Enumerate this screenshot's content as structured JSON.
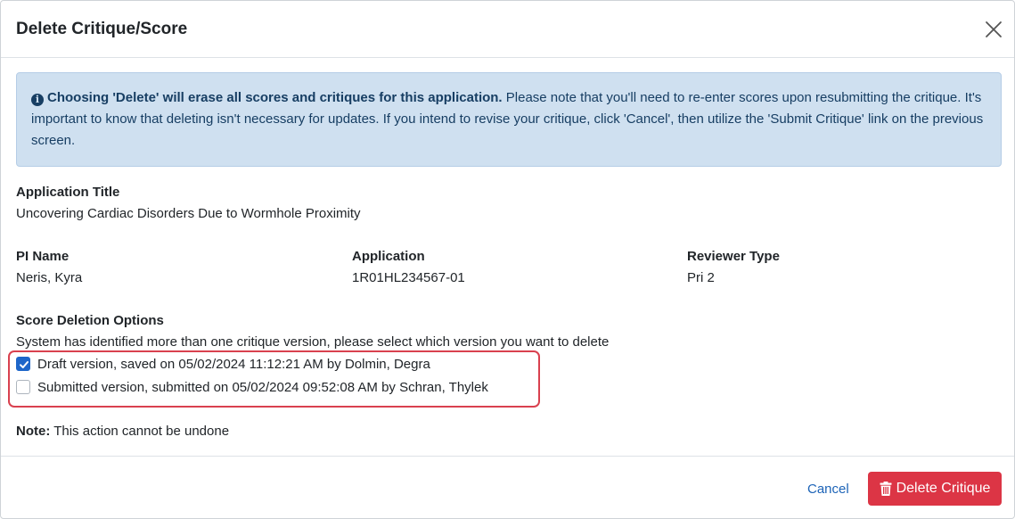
{
  "modal": {
    "title": "Delete Critique/Score"
  },
  "alert": {
    "bold_text": "Choosing 'Delete' will erase all scores and critiques for this application.",
    "text": " Please note that you'll need to re-enter scores upon resubmitting the critique. It's important to know that deleting isn't necessary for updates. If you intend to revise your critique, click 'Cancel', then utilize the 'Submit Critique' link on the previous screen."
  },
  "application_title": {
    "label": "Application Title",
    "value": "Uncovering Cardiac Disorders Due to Wormhole Proximity"
  },
  "pi_name": {
    "label": "PI Name",
    "value": "Neris, Kyra"
  },
  "application": {
    "label": "Application",
    "value": "1R01HL234567-01"
  },
  "reviewer_type": {
    "label": "Reviewer Type",
    "value": "Pri 2"
  },
  "score_deletion": {
    "label": "Score Deletion Options",
    "instruction": "System has identified more than one critique version, please select which version you want to delete",
    "options": [
      {
        "label": "Draft version, saved on 05/02/2024 11:12:21 AM by Dolmin, Degra",
        "checked": true
      },
      {
        "label": "Submitted version, submitted on 05/02/2024 09:52:08 AM by Schran, Thylek",
        "checked": false
      }
    ]
  },
  "note": {
    "label": "Note:",
    "text": " This action cannot be undone"
  },
  "footer": {
    "cancel_label": "Cancel",
    "delete_label": "Delete Critique"
  },
  "colors": {
    "alert_bg": "#cfe0f0",
    "alert_text": "#173e63",
    "danger": "#dc3545",
    "link": "#1c63b7",
    "checkbox_checked": "#1e66c9",
    "highlight_border": "#d9414f"
  },
  "icons": {
    "close": "close-icon",
    "info": "info-circle-icon",
    "trash": "trash-icon",
    "check": "check-icon"
  }
}
